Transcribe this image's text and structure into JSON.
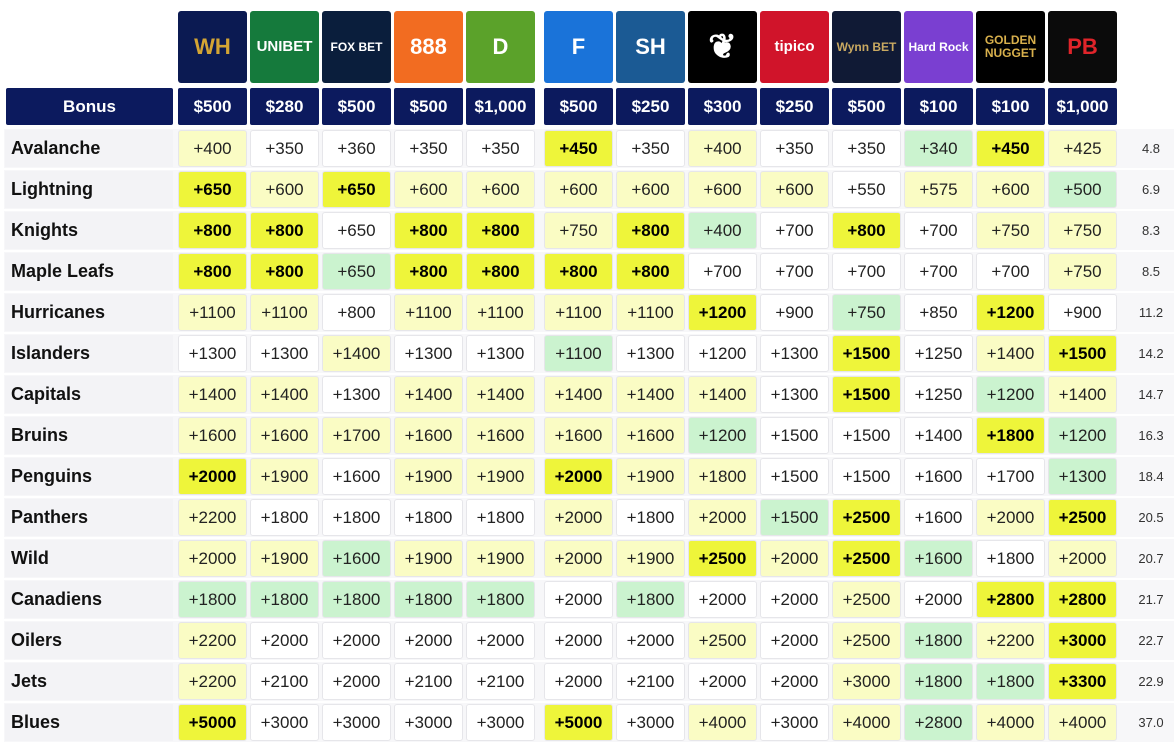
{
  "header": {
    "bonus_label": "Bonus",
    "books": [
      {
        "id": "williamhill",
        "text": "WH",
        "bg": "#0b1a52",
        "fg": "#d4a534"
      },
      {
        "id": "unibet",
        "text": "UNIBET",
        "bg": "#157a3c",
        "fg": "#ffffff"
      },
      {
        "id": "foxbet",
        "text": "FOX BET",
        "bg": "#0a1e3c",
        "fg": "#ffffff"
      },
      {
        "id": "888sport",
        "text": "888",
        "bg": "#f26c21",
        "fg": "#ffffff"
      },
      {
        "id": "draftkings",
        "text": "D",
        "bg": "#5ba22a",
        "fg": "#ffffff"
      },
      {
        "id": "fanduel",
        "text": "F",
        "bg": "#1a73d9",
        "fg": "#ffffff"
      },
      {
        "id": "sh",
        "text": "SH",
        "bg": "#1b5a94",
        "fg": "#ffffff"
      },
      {
        "id": "laurel",
        "text": "",
        "bg": "#000000",
        "fg": "#ffffff"
      },
      {
        "id": "tipico",
        "text": "tipico",
        "bg": "#d0142a",
        "fg": "#ffffff"
      },
      {
        "id": "wynnbet",
        "text": "Wynn BET",
        "bg": "#101a35",
        "fg": "#c9a961"
      },
      {
        "id": "hardrock",
        "text": "Hard Rock",
        "bg": "#7a3fd1",
        "fg": "#ffffff"
      },
      {
        "id": "goldennugget",
        "text": "GOLDEN NUGGET",
        "bg": "#000000",
        "fg": "#d8b04c"
      },
      {
        "id": "pointsbet",
        "text": "PB",
        "bg": "#0b0b0b",
        "fg": "#e0242a"
      }
    ],
    "bonuses": [
      "$500",
      "$280",
      "$500",
      "$500",
      "$1,000",
      "$500",
      "$250",
      "$300",
      "$250",
      "$500",
      "$100",
      "$100",
      "$1,000"
    ]
  },
  "colors": {
    "header_bg": "#0c1a5e",
    "best": "#eef53a",
    "light_yellow": "#fafcc4",
    "light_green": "#cbf3cf",
    "white": "#ffffff"
  },
  "rows": [
    {
      "team": "Avalanche",
      "odds": [
        "+400",
        "+350",
        "+360",
        "+350",
        "+350",
        "+450",
        "+350",
        "+400",
        "+350",
        "+350",
        "+340",
        "+450",
        "+425"
      ],
      "shade": [
        "y",
        "w",
        "w",
        "w",
        "w",
        "b",
        "w",
        "y",
        "w",
        "w",
        "g",
        "b",
        "y"
      ],
      "avg": "4.8"
    },
    {
      "team": "Lightning",
      "odds": [
        "+650",
        "+600",
        "+650",
        "+600",
        "+600",
        "+600",
        "+600",
        "+600",
        "+600",
        "+550",
        "+575",
        "+600",
        "+500"
      ],
      "shade": [
        "b",
        "y",
        "b",
        "y",
        "y",
        "y",
        "y",
        "y",
        "y",
        "w",
        "y",
        "y",
        "g"
      ],
      "avg": "6.9"
    },
    {
      "team": "Knights",
      "odds": [
        "+800",
        "+800",
        "+650",
        "+800",
        "+800",
        "+750",
        "+800",
        "+400",
        "+700",
        "+800",
        "+700",
        "+750",
        "+750"
      ],
      "shade": [
        "b",
        "b",
        "w",
        "b",
        "b",
        "y",
        "b",
        "g",
        "w",
        "b",
        "w",
        "y",
        "y"
      ],
      "avg": "8.3"
    },
    {
      "team": "Maple Leafs",
      "odds": [
        "+800",
        "+800",
        "+650",
        "+800",
        "+800",
        "+800",
        "+800",
        "+700",
        "+700",
        "+700",
        "+700",
        "+700",
        "+750"
      ],
      "shade": [
        "b",
        "b",
        "g",
        "b",
        "b",
        "b",
        "b",
        "w",
        "w",
        "w",
        "w",
        "w",
        "y"
      ],
      "avg": "8.5"
    },
    {
      "team": "Hurricanes",
      "odds": [
        "+1100",
        "+1100",
        "+800",
        "+1100",
        "+1100",
        "+1100",
        "+1100",
        "+1200",
        "+900",
        "+750",
        "+850",
        "+1200",
        "+900"
      ],
      "shade": [
        "y",
        "y",
        "w",
        "y",
        "y",
        "y",
        "y",
        "b",
        "w",
        "g",
        "w",
        "b",
        "w"
      ],
      "avg": "11.2"
    },
    {
      "team": "Islanders",
      "odds": [
        "+1300",
        "+1300",
        "+1400",
        "+1300",
        "+1300",
        "+1100",
        "+1300",
        "+1200",
        "+1300",
        "+1500",
        "+1250",
        "+1400",
        "+1500"
      ],
      "shade": [
        "w",
        "w",
        "y",
        "w",
        "w",
        "g",
        "w",
        "w",
        "w",
        "b",
        "w",
        "y",
        "b"
      ],
      "avg": "14.2"
    },
    {
      "team": "Capitals",
      "odds": [
        "+1400",
        "+1400",
        "+1300",
        "+1400",
        "+1400",
        "+1400",
        "+1400",
        "+1400",
        "+1300",
        "+1500",
        "+1250",
        "+1200",
        "+1400"
      ],
      "shade": [
        "y",
        "y",
        "w",
        "y",
        "y",
        "y",
        "y",
        "y",
        "w",
        "b",
        "w",
        "g",
        "y"
      ],
      "avg": "14.7"
    },
    {
      "team": "Bruins",
      "odds": [
        "+1600",
        "+1600",
        "+1700",
        "+1600",
        "+1600",
        "+1600",
        "+1600",
        "+1200",
        "+1500",
        "+1500",
        "+1400",
        "+1800",
        "+1200"
      ],
      "shade": [
        "y",
        "y",
        "y",
        "y",
        "y",
        "y",
        "y",
        "g",
        "w",
        "w",
        "w",
        "b",
        "g"
      ],
      "avg": "16.3"
    },
    {
      "team": "Penguins",
      "odds": [
        "+2000",
        "+1900",
        "+1600",
        "+1900",
        "+1900",
        "+2000",
        "+1900",
        "+1800",
        "+1500",
        "+1500",
        "+1600",
        "+1700",
        "+1300"
      ],
      "shade": [
        "b",
        "y",
        "w",
        "y",
        "y",
        "b",
        "y",
        "y",
        "w",
        "w",
        "w",
        "w",
        "g"
      ],
      "avg": "18.4"
    },
    {
      "team": "Panthers",
      "odds": [
        "+2200",
        "+1800",
        "+1800",
        "+1800",
        "+1800",
        "+2000",
        "+1800",
        "+2000",
        "+1500",
        "+2500",
        "+1600",
        "+2000",
        "+2500"
      ],
      "shade": [
        "y",
        "w",
        "w",
        "w",
        "w",
        "y",
        "w",
        "y",
        "g",
        "b",
        "w",
        "y",
        "b"
      ],
      "avg": "20.5"
    },
    {
      "team": "Wild",
      "odds": [
        "+2000",
        "+1900",
        "+1600",
        "+1900",
        "+1900",
        "+2000",
        "+1900",
        "+2500",
        "+2000",
        "+2500",
        "+1600",
        "+1800",
        "+2000"
      ],
      "shade": [
        "y",
        "y",
        "g",
        "y",
        "y",
        "y",
        "y",
        "b",
        "y",
        "b",
        "g",
        "w",
        "y"
      ],
      "avg": "20.7"
    },
    {
      "team": "Canadiens",
      "odds": [
        "+1800",
        "+1800",
        "+1800",
        "+1800",
        "+1800",
        "+2000",
        "+1800",
        "+2000",
        "+2000",
        "+2500",
        "+2000",
        "+2800",
        "+2800"
      ],
      "shade": [
        "g",
        "g",
        "g",
        "g",
        "g",
        "w",
        "g",
        "w",
        "w",
        "y",
        "w",
        "b",
        "b"
      ],
      "avg": "21.7"
    },
    {
      "team": "Oilers",
      "odds": [
        "+2200",
        "+2000",
        "+2000",
        "+2000",
        "+2000",
        "+2000",
        "+2000",
        "+2500",
        "+2000",
        "+2500",
        "+1800",
        "+2200",
        "+3000"
      ],
      "shade": [
        "y",
        "w",
        "w",
        "w",
        "w",
        "w",
        "w",
        "y",
        "w",
        "y",
        "g",
        "y",
        "b"
      ],
      "avg": "22.7"
    },
    {
      "team": "Jets",
      "odds": [
        "+2200",
        "+2100",
        "+2000",
        "+2100",
        "+2100",
        "+2000",
        "+2100",
        "+2000",
        "+2000",
        "+3000",
        "+1800",
        "+1800",
        "+3300"
      ],
      "shade": [
        "y",
        "w",
        "w",
        "w",
        "w",
        "w",
        "w",
        "w",
        "w",
        "y",
        "g",
        "g",
        "b"
      ],
      "avg": "22.9"
    },
    {
      "team": "Blues",
      "odds": [
        "+5000",
        "+3000",
        "+3000",
        "+3000",
        "+3000",
        "+5000",
        "+3000",
        "+4000",
        "+3000",
        "+4000",
        "+2800",
        "+4000",
        "+4000"
      ],
      "shade": [
        "b",
        "w",
        "w",
        "w",
        "w",
        "b",
        "w",
        "y",
        "w",
        "y",
        "g",
        "y",
        "y"
      ],
      "avg": "37.0"
    }
  ]
}
